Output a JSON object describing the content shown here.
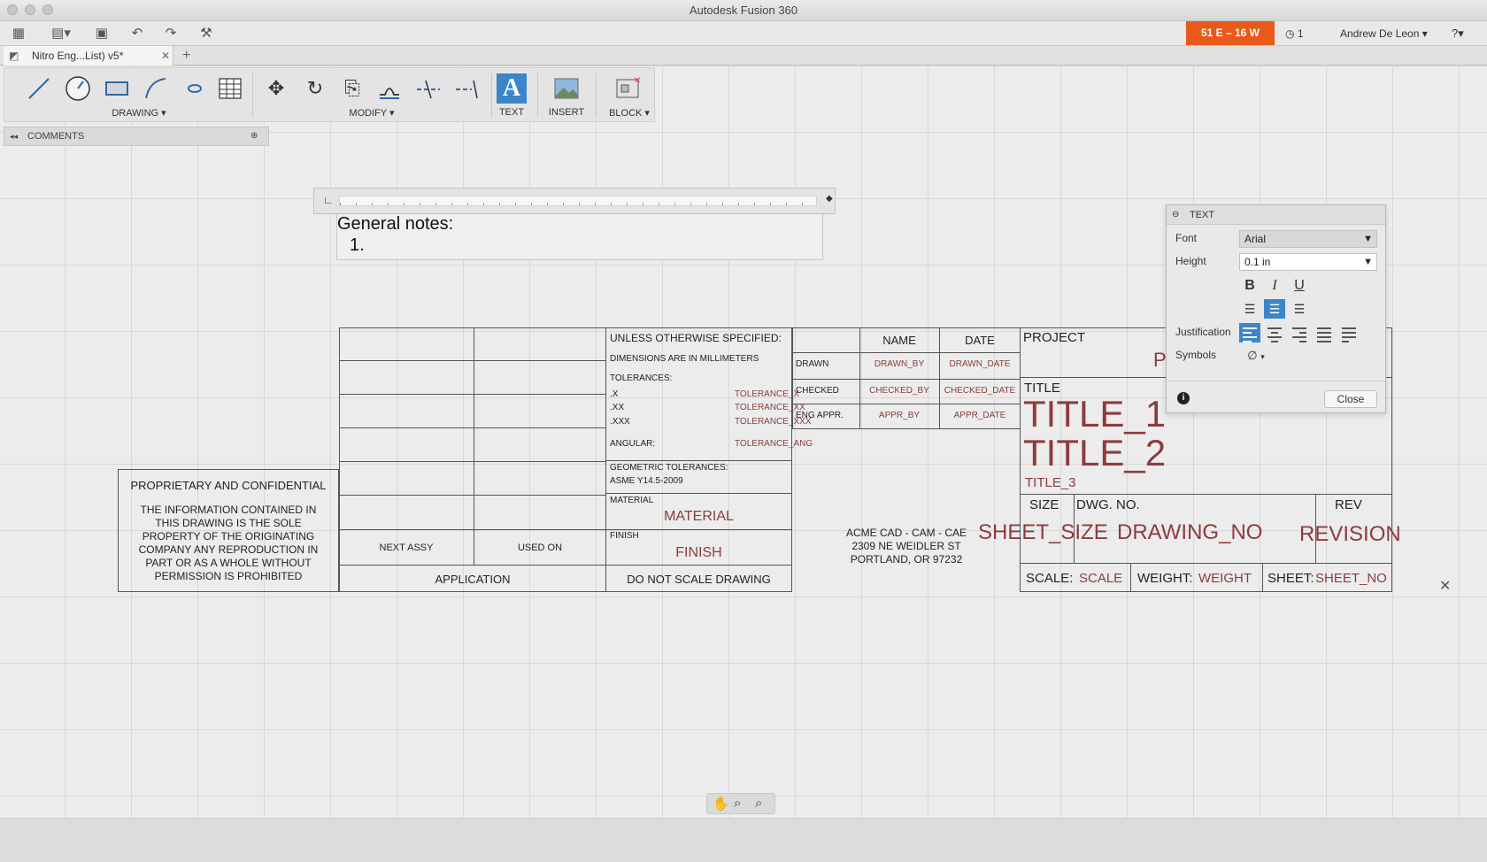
{
  "window": {
    "title": "Autodesk Fusion 360"
  },
  "quick_access": {
    "sheet_badge": "51 E – 16 W",
    "jobs_count": "1",
    "user_name": "Andrew De Leon"
  },
  "tab": {
    "label": "Nitro Eng...List) v5*"
  },
  "toolbar": {
    "drawing_label": "DRAWING",
    "modify_label": "MODIFY",
    "text_label": "TEXT",
    "insert_label": "INSERT",
    "block_label": "BLOCK"
  },
  "comments": {
    "label": "COMMENTS"
  },
  "notes": {
    "title": "General notes:",
    "item": "1."
  },
  "title_block": {
    "unless": "UNLESS OTHERWISE SPECIFIED:",
    "dimensions": "DIMENSIONS ARE IN MILLIMETERS",
    "tolerances": "TOLERANCES:",
    "tol_x": ".X",
    "tol_xx": ".XX",
    "tol_xxx": ".XXX",
    "angular": "ANGULAR:",
    "tol_x_val": "TOLERANCE_X",
    "tol_xx_val": "TOLERANCE_XX",
    "tol_xxx_val": "TOLERANCE_XXX",
    "tol_ang_val": "TOLERANCE_ANG",
    "geometric": "GEOMETRIC TOLERANCES:",
    "asme": "ASME Y14.5-2009",
    "material_label": "MATERIAL",
    "material_value": "MATERIAL",
    "finish_label": "FINISH",
    "finish_value": "FINISH",
    "do_not_scale": "DO NOT SCALE DRAWING",
    "name_header": "NAME",
    "date_header": "DATE",
    "drawn": "DRAWN",
    "checked": "CHECKED",
    "eng_appr": "ENG APPR.",
    "drawn_by": "DRAWN_BY",
    "drawn_date": "DRAWN_DATE",
    "checked_by": "CHECKED_BY",
    "checked_date": "CHECKED_DATE",
    "appr_by": "APPR_BY",
    "appr_date": "APPR_DATE",
    "company_1": "ACME  CAD - CAM - CAE",
    "company_2": "2309 NE WEIDLER ST",
    "company_3": "PORTLAND, OR 97232",
    "project_label": "PROJECT",
    "project_value_partial": "P",
    "title_label": "TITLE",
    "title_1": "TITLE_1",
    "title_2": "TITLE_2",
    "title_3": "TITLE_3",
    "size_label": "SIZE",
    "dwg_no_label": "DWG. NO.",
    "rev_label": "REV",
    "sheet_size": "SHEET_SIZE",
    "drawing_no": "DRAWING_NO",
    "revision": "REVISION",
    "scale_label": "SCALE:",
    "scale_value": "SCALE",
    "weight_label": "WEIGHT:",
    "weight_value": "WEIGHT",
    "sheet_label": "SHEET:",
    "sheet_value": "SHEET_NO",
    "next_assy": "NEXT ASSY",
    "used_on": "USED ON",
    "application": "APPLICATION",
    "proprietary_title": "PROPRIETARY AND CONFIDENTIAL",
    "proprietary_body_1": "THE INFORMATION CONTAINED IN",
    "proprietary_body_2": "THIS DRAWING IS THE SOLE",
    "proprietary_body_3": "PROPERTY OF THE ORIGINATING",
    "proprietary_body_4": "COMPANY ANY REPRODUCTION IN",
    "proprietary_body_5": "PART OR AS A WHOLE WITHOUT",
    "proprietary_body_6": "PERMISSION IS PROHIBITED"
  },
  "text_dialog": {
    "title": "TEXT",
    "font_label": "Font",
    "font_value": "Arial",
    "height_label": "Height",
    "height_value": "0.1 in",
    "bold": "B",
    "italic": "I",
    "underline": "U",
    "justification_label": "Justification",
    "symbols_label": "Symbols",
    "symbols_value": "∅",
    "close_label": "Close"
  },
  "colors": {
    "accent": "#3a86c8",
    "badge": "#e8591a",
    "drawing_red": "#8c3c3c"
  }
}
